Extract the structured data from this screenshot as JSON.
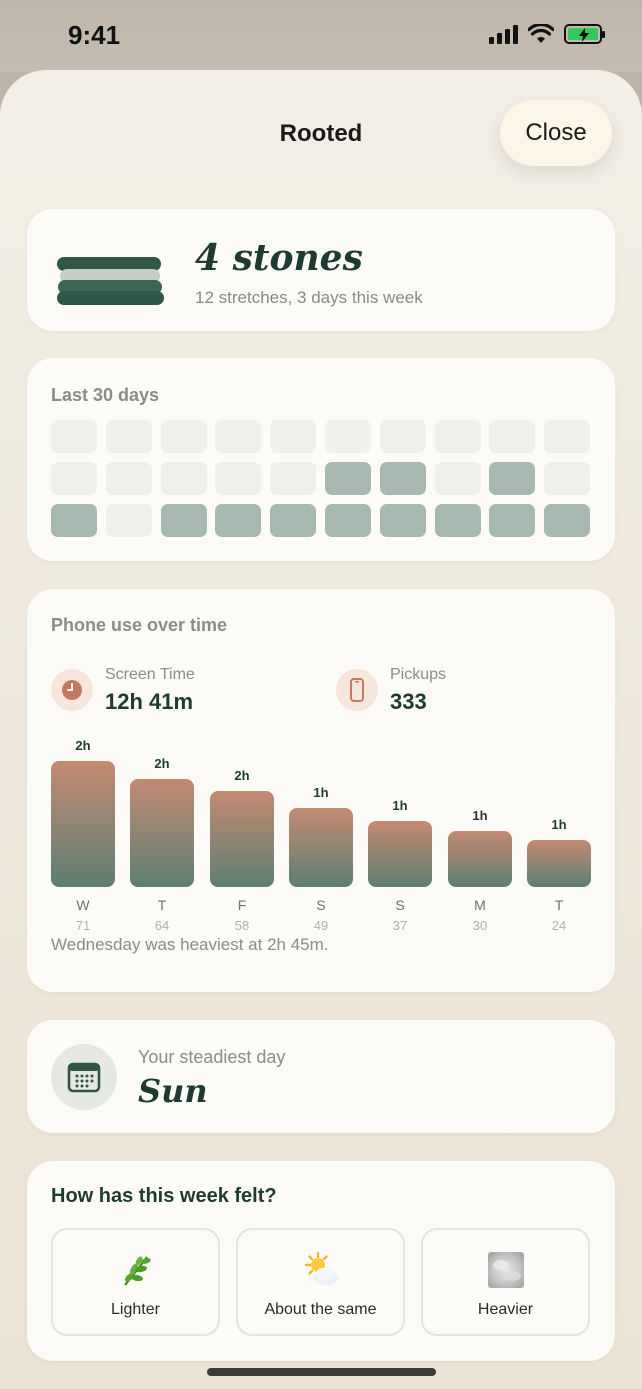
{
  "status_bar": {
    "time": "9:41"
  },
  "sheet": {
    "title": "Rooted",
    "close_label": "Close"
  },
  "stones": {
    "title": "4 stones",
    "subtitle": "12 stretches, 3 days this week",
    "colors": [
      "#2f5647",
      "#c5cdc4",
      "#3c6756",
      "#2f5647"
    ]
  },
  "calendar": {
    "label": "Last 30 days",
    "rows": [
      [
        0,
        0,
        0,
        0,
        0,
        0,
        0,
        0,
        0,
        0
      ],
      [
        0,
        0,
        0,
        0,
        0,
        1,
        1,
        0,
        1,
        0
      ],
      [
        1,
        0,
        1,
        1,
        1,
        1,
        1,
        1,
        1,
        1
      ]
    ]
  },
  "usage": {
    "label": "Phone use over time",
    "screen_time": {
      "label": "Screen Time",
      "value": "12h 41m",
      "icon": "clock-icon"
    },
    "pickups": {
      "label": "Pickups",
      "value": "333",
      "icon": "phone-icon"
    },
    "note": "Wednesday was heaviest at 2h 45m."
  },
  "chart_data": {
    "type": "bar",
    "categories": [
      "W",
      "T",
      "F",
      "S",
      "S",
      "M",
      "T"
    ],
    "values_minutes": [
      165,
      142,
      126,
      103,
      87,
      73,
      62
    ],
    "top_labels": [
      "2h",
      "2h",
      "2h",
      "1h",
      "1h",
      "1h",
      "1h"
    ],
    "pickups": [
      "71",
      "64",
      "58",
      "49",
      "37",
      "30",
      "24"
    ],
    "ylim": [
      0,
      165
    ],
    "colors": {
      "top": "#c48a72",
      "bottom": "#5d7f71"
    }
  },
  "steadiest": {
    "label": "Your steadiest day",
    "value": "Sun",
    "icon": "calendar-icon"
  },
  "feel": {
    "question": "How has this week felt?",
    "options": [
      {
        "label": "Lighter",
        "icon": "herb-icon"
      },
      {
        "label": "About the same",
        "icon": "sun-behind-cloud-icon"
      },
      {
        "label": "Heavier",
        "icon": "fog-icon"
      }
    ]
  }
}
